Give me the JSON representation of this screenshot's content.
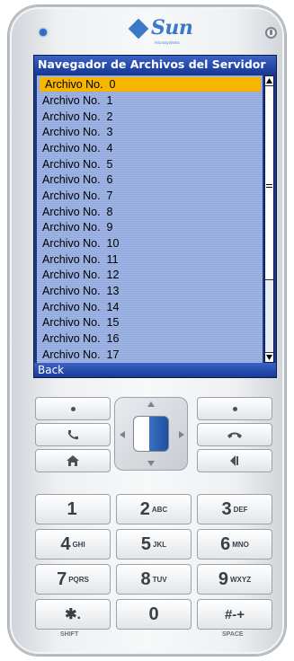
{
  "device": {
    "brand_logo": "Sun",
    "brand_sub": "microsystems",
    "colors": {
      "title_bar": "#2448a8",
      "list_bg": "#9db2e3",
      "selection": "#f7b500",
      "text": "#000000"
    }
  },
  "screen": {
    "title": "Navegador de Archivos del Servidor",
    "items": [
      "Archivo No.  0",
      "Archivo No.  1",
      "Archivo No.  2",
      "Archivo No.  3",
      "Archivo No.  4",
      "Archivo No.  5",
      "Archivo No.  6",
      "Archivo No.  7",
      "Archivo No.  8",
      "Archivo No.  9",
      "Archivo No.  10",
      "Archivo No.  11",
      "Archivo No.  12",
      "Archivo No.  13",
      "Archivo No.  14",
      "Archivo No.  15",
      "Archivo No.  16",
      "Archivo No.  17"
    ],
    "selected_index": 0,
    "soft_key_label": "Back"
  },
  "keypad": {
    "icons": {
      "left_soft": "dot-icon",
      "right_soft": "dot-icon",
      "call": "phone-call-icon",
      "end": "phone-end-icon",
      "home": "home-icon",
      "clear": "backspace-icon"
    },
    "keys": [
      {
        "digit": "1",
        "letters": ""
      },
      {
        "digit": "2",
        "letters": "ABC"
      },
      {
        "digit": "3",
        "letters": "DEF"
      },
      {
        "digit": "4",
        "letters": "GHI"
      },
      {
        "digit": "5",
        "letters": "JKL"
      },
      {
        "digit": "6",
        "letters": "MNO"
      },
      {
        "digit": "7",
        "letters": "PQRS"
      },
      {
        "digit": "8",
        "letters": "TUV"
      },
      {
        "digit": "9",
        "letters": "WXYZ"
      },
      {
        "digit": "✱.",
        "letters": ""
      },
      {
        "digit": "0",
        "letters": ""
      },
      {
        "digit": "#-+",
        "letters": ""
      }
    ],
    "shift_label": "SHIFT",
    "space_label": "SPACE"
  }
}
